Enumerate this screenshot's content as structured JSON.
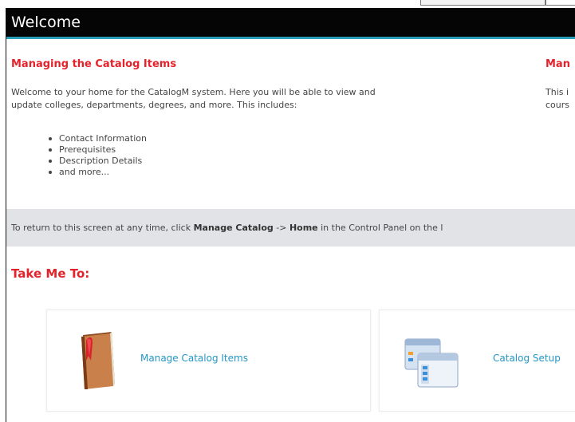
{
  "window": {
    "title": "Welcome"
  },
  "left_section": {
    "heading": "Managing the Catalog Items",
    "intro_line1": "Welcome to your home for the CatalogM system. Here you will be able to view and",
    "intro_line2": "update colleges, departments, degrees, and more. This includes:",
    "items": [
      "Contact Information",
      "Prerequisites",
      "Description Details",
      "and more..."
    ]
  },
  "right_section": {
    "heading_partial": "Man",
    "line1_partial": "This i",
    "line2_partial": "cours"
  },
  "note": {
    "prefix": "To return to this screen at any time, click ",
    "menu": "Manage Catalog",
    "arrow": " -> ",
    "item": "Home",
    "suffix": " in the Control Panel on the l"
  },
  "take_me_to": {
    "heading": "Take Me To:",
    "cards": [
      {
        "label": "Manage Catalog Items",
        "icon": "book-icon"
      },
      {
        "label": "Catalog Setup",
        "icon": "window-settings-icon"
      }
    ]
  }
}
